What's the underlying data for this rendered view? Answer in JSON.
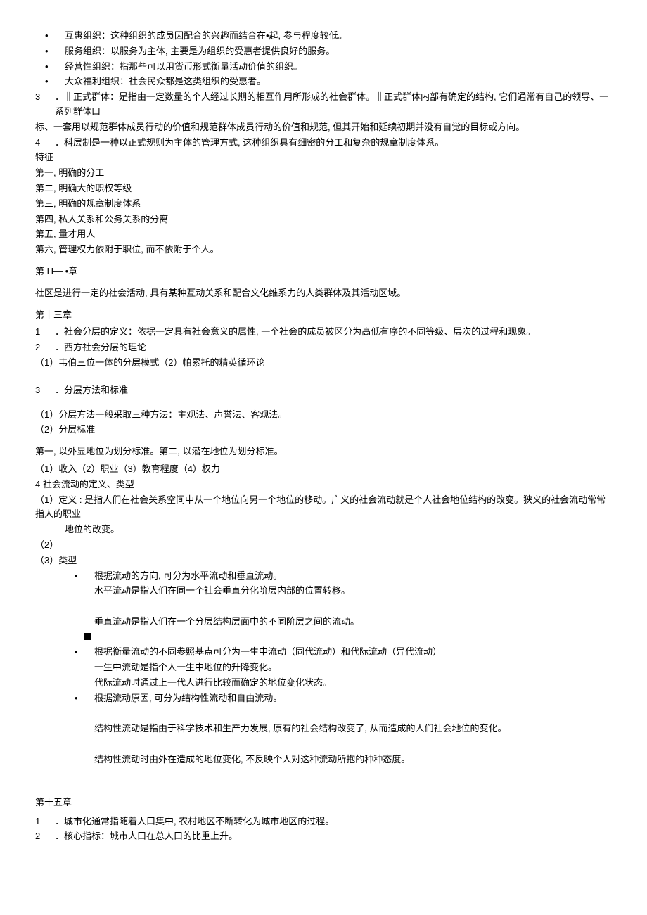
{
  "top_bullets": [
    "互惠组织：这种组织的成员因配合的兴趣而结合在•起, 参与程度较低。",
    "服务组织：以服务为主体, 主要是为组织的受惠者提供良好的服务。",
    "经营性组织：指那些可以用货币形式衡量活动价值的组织。",
    "大众福利组织：社会民众都是这类组织的受惠者。"
  ],
  "item3": {
    "num": "3",
    "text": "．非正式群体：是指由一定数量的个人经过长期的相互作用所形成的社会群体。非正式群体内部有确定的结构, 它们通常有自己的领导、一系列群体口"
  },
  "item3_cont": "标、一套用以规范群体成员行动的价值和规范群体成员行动的价值和规范, 但其开始和延续初期并没有自觉的目标或方向。",
  "item4": {
    "num": "4",
    "text": "．科层制是一种以正式规则为主体的管理方式, 这种组织具有细密的分工和复杂的规章制度体系。"
  },
  "features_label": "特征",
  "features": [
    "第一, 明确的分工",
    "第二, 明确大的职权等级",
    "第三, 明确的规章制度体系",
    "第四, 私人关系和公务关系的分离",
    "第五, 量才用人",
    "第六, 管理权力依附于职位, 而不依附于个人。"
  ],
  "chapterH": {
    "title": "第 H— •章",
    "text": "社区是进行一定的社会活动, 具有某种互动关系和配合文化维系力的人类群体及其活动区域。"
  },
  "chapter13": {
    "title": "第十三章",
    "item1": {
      "num": "1",
      "text": "．社会分层的定义：依据一定具有社会意义的属性, 一个社会的成员被区分为高低有序的不同等级、层次的过程和现象。"
    },
    "item2": {
      "num": "2",
      "text": "．西方社会分层的理论"
    },
    "item2_sub": "（1）韦伯三位一体的分层模式（2）帕累托的精英循环论",
    "item3": {
      "num": "3",
      "text": "．分层方法和标准"
    },
    "item3_sub1": "（1）分层方法一般采取三种方法：主观法、声誉法、客观法。",
    "item3_sub2": "（2）分层标准",
    "item3_body1": "第一, 以外显地位为划分标准。第二, 以潜在地位为划分标准。",
    "item3_body2": "（1）收入（2）职业（3）教育程度（4）权力",
    "item4_line": "4 社会流动的定义、类型",
    "item4_def": "（1）定义 : 是指人们在社会关系空间中从一个地位向另一个地位的移动。广义的社会流动就是个人社会地位结构的改变。狭义的社会流动常常指人的职业",
    "item4_def_cont": "地位的改变。",
    "item4_2": "（2）",
    "item4_3": "（3）类型",
    "type_bullets": [
      {
        "main": "根据流动的方向, 可分为水平流动和垂直流动。",
        "sub": [
          "水平流动是指人们在同一个社会垂直分化阶层内部的位置转移。",
          "",
          "垂直流动是指人们在一个分层结构层面中的不同阶层之间的流动。"
        ]
      },
      {
        "main": "根据衡量流动的不同参照基点可分为一生中流动（同代流动）和代际流动（异代流动）",
        "sub": [
          "一生中流动是指个人一生中地位的升降变化。",
          "代际流动时通过上一代人进行比较而确定的地位变化状态。"
        ]
      },
      {
        "main": "根据流动原因, 可分为结构性流动和自由流动。",
        "sub": [
          "",
          "结构性流动是指由于科学技术和生产力发展, 原有的社会结构改变了, 从而造成的人们社会地位的变化。",
          "",
          "结构性流动时由外在造成的地位变化, 不反映个人对这种流动所抱的种种态度。"
        ]
      }
    ]
  },
  "chapter15": {
    "title": "第十五章",
    "item1": {
      "num": "1",
      "text": "．城市化通常指随着人口集中, 农村地区不断转化为城市地区的过程。"
    },
    "item2": {
      "num": "2",
      "text": "．核心指标：城市人口在总人口的比重上升。"
    }
  }
}
